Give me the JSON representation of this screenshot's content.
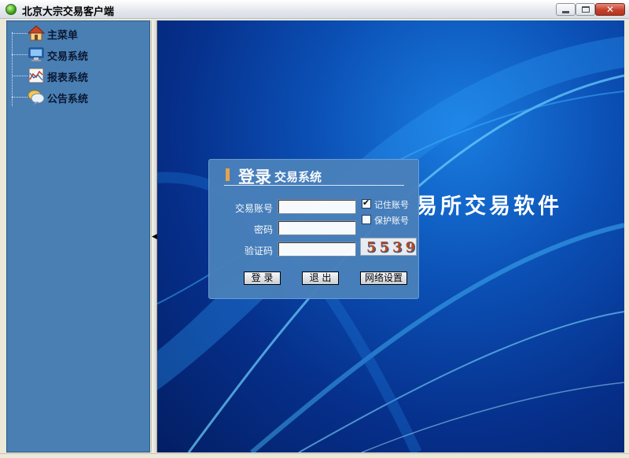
{
  "window": {
    "title": "北京大宗交易客户端"
  },
  "sidebar": {
    "items": [
      {
        "label": "主菜单",
        "icon": "home-icon"
      },
      {
        "label": "交易系统",
        "icon": "monitor-icon"
      },
      {
        "label": "报表系统",
        "icon": "chart-report-icon"
      },
      {
        "label": "公告系统",
        "icon": "chat-bubble-icon"
      }
    ]
  },
  "main": {
    "banner_text": "易所交易软件"
  },
  "login": {
    "title_main": "登录",
    "title_sub": "交易系统",
    "account_label": "交易账号",
    "account_value": "",
    "password_label": "密码",
    "password_value": "",
    "captcha_label": "验证码",
    "captcha_value": "",
    "captcha_code": "5539",
    "remember_label": "记住账号",
    "remember_checked": true,
    "protect_label": "保护账号",
    "protect_checked": false,
    "login_button": "登 录",
    "exit_button": "退 出",
    "network_button": "网络设置"
  },
  "colors": {
    "sidebar_bg": "#4a7fb4",
    "dialog_bg": "#4880bb",
    "accent_bar": "#f0a64a",
    "main_bg_dark": "#031e63"
  }
}
